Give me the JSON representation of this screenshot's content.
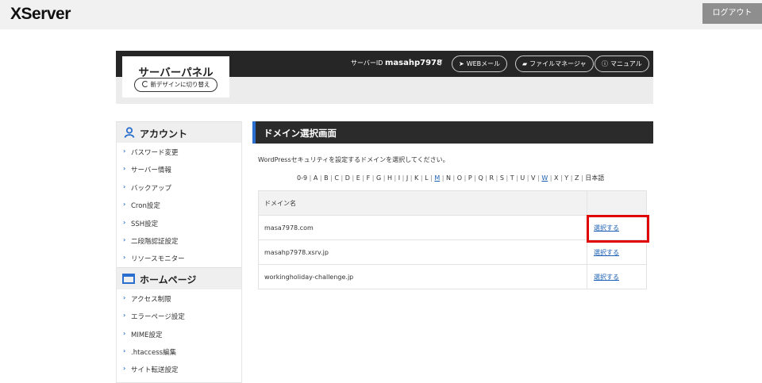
{
  "app": {
    "logo": "XServer",
    "logout_label": "ログアウト"
  },
  "panel": {
    "title": "サーバーパネル",
    "new_design_label": "新デザインに切り替え",
    "server_id_label": "サーバーID",
    "server_id_value": "masahp7978",
    "separator": "/",
    "links": [
      {
        "icon": "send-icon",
        "label": "WEBメール"
      },
      {
        "icon": "folder-icon",
        "label": "ファイルマネージャ"
      },
      {
        "icon": "help-icon",
        "label": "マニュアル"
      }
    ]
  },
  "sidebar": {
    "account": {
      "title": "アカウント",
      "items": [
        "パスワード変更",
        "サーバー情報",
        "バックアップ",
        "Cron設定",
        "SSH設定",
        "二段階認証設定",
        "リソースモニター"
      ]
    },
    "homepage": {
      "title": "ホームページ",
      "items": [
        "アクセス制限",
        "エラーページ設定",
        "MIME設定",
        ".htaccess編集",
        "サイト転送設定"
      ]
    }
  },
  "main": {
    "title": "ドメイン選択画面",
    "intro": "WordPressセキュリティを設定するドメインを選択してください。",
    "alpha_index": {
      "items": [
        "0-9",
        "A",
        "B",
        "C",
        "D",
        "E",
        "F",
        "G",
        "H",
        "I",
        "J",
        "K",
        "L",
        "M",
        "N",
        "O",
        "P",
        "Q",
        "R",
        "S",
        "T",
        "U",
        "V",
        "W",
        "X",
        "Y",
        "Z",
        "日本語"
      ],
      "linked": [
        "M",
        "W"
      ]
    },
    "table": {
      "header": "ドメイン名",
      "rows": [
        {
          "domain": "masa7978.com",
          "action": "選択する"
        },
        {
          "domain": "masahp7978.xsrv.jp",
          "action": "選択する"
        },
        {
          "domain": "workingholiday-challenge.jp",
          "action": "選択する"
        }
      ]
    }
  },
  "colors": {
    "accent": "#2a6fcf",
    "highlight": "#e00000",
    "dark_bar": "#262626"
  }
}
